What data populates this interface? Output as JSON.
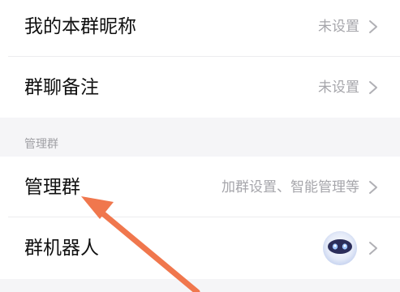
{
  "rows": [
    {
      "label": "我的本群昵称",
      "value": "未设置"
    },
    {
      "label": "群聊备注",
      "value": "未设置"
    },
    {
      "label": "管理群",
      "value": "加群设置、智能管理等"
    },
    {
      "label": "群机器人",
      "value": ""
    }
  ],
  "section": {
    "title": "管理群"
  },
  "icons": {
    "chevron": "chevron-right-icon",
    "bot": "robot-avatar-icon"
  },
  "colors": {
    "arrow": "#f0774d",
    "label": "#111111",
    "value": "#a6a6ab",
    "background": "#f5f5f7"
  }
}
